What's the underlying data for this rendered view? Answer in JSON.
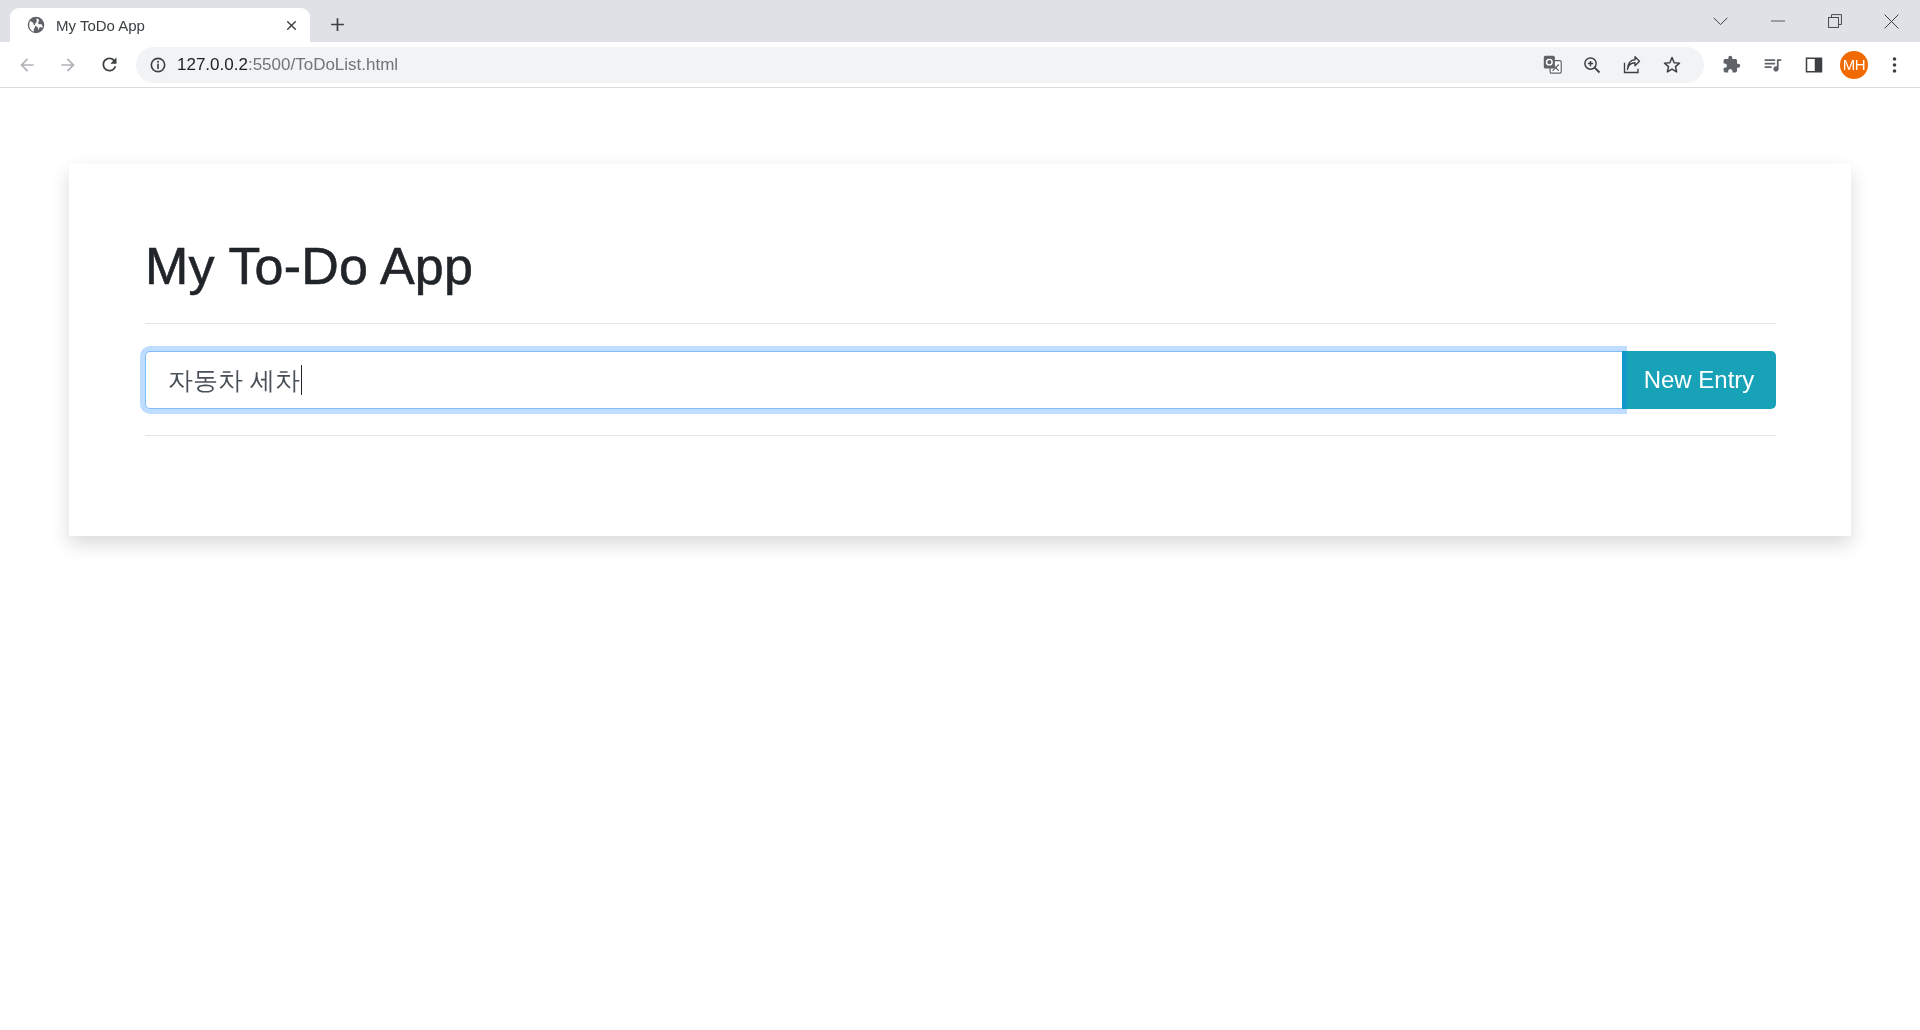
{
  "browser": {
    "tabs": [
      {
        "title": "My ToDo App",
        "selected": true
      }
    ],
    "navigation": {
      "back": {
        "disabled": true
      },
      "forward": {
        "disabled": true
      }
    },
    "address": {
      "host": "127.0.0.2",
      "rest": ":5500/ToDoList.html"
    },
    "profile": {
      "initials": "MH"
    }
  },
  "app": {
    "title": "My To-Do App",
    "entry": {
      "value": "자동차 세차",
      "focused": true
    },
    "button": "New Entry"
  }
}
